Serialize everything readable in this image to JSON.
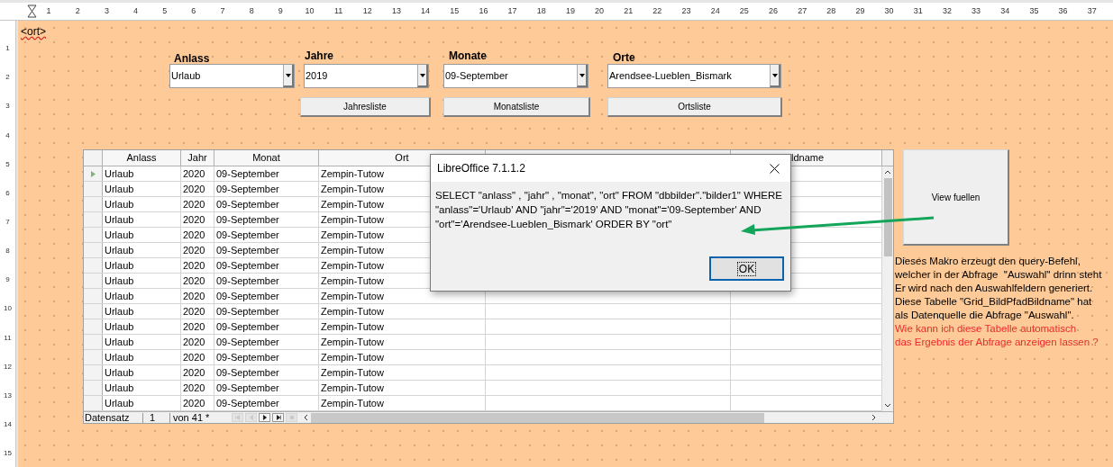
{
  "ruler": {
    "horizontal": [
      "1",
      "2",
      "3",
      "4",
      "5",
      "6",
      "7",
      "8",
      "9",
      "10",
      "11",
      "12",
      "13",
      "14",
      "15",
      "16",
      "17",
      "18",
      "19",
      "20",
      "21",
      "22",
      "23",
      "24",
      "25",
      "26",
      "27",
      "28",
      "29",
      "30",
      "31",
      "32",
      "33",
      "34",
      "35",
      "36",
      "37"
    ],
    "vertical": [
      "1",
      "2",
      "3",
      "4",
      "5",
      "6",
      "7",
      "8",
      "9",
      "10",
      "11",
      "12",
      "13",
      "14",
      "15"
    ]
  },
  "form": {
    "tag": "<ort>",
    "fields": [
      {
        "label": "Anlass",
        "value": "Urlaub"
      },
      {
        "label": "Jahre",
        "value": "2019"
      },
      {
        "label": "Monate",
        "value": "09-September"
      },
      {
        "label": "Orte",
        "value": "Arendsee-Lueblen_Bismark"
      }
    ],
    "list_buttons": [
      "Jahresliste",
      "Monatsliste",
      "Ortsliste"
    ],
    "view_button": "View fuellen",
    "note": [
      {
        "kind": "info",
        "lines": [
          "Dieses Makro erzeugt den query-Befehl,",
          "welcher in der Abfrage  \"Auswahl\" drinn steht",
          "Er wird nach den Auswahlfeldern generiert.",
          "Diese Tabelle \"Grid_BildPfadBildname\" hat",
          "als Datenquelle die Abfrage \"Auswahl\"."
        ]
      },
      {
        "kind": "question",
        "lines": [
          "Wie kann ich diese Tabelle automatisch",
          "das Ergebnis der Abfrage anzeigen lassen ?"
        ]
      }
    ]
  },
  "table": {
    "columns": [
      "Anlass",
      "Jahr",
      "Monat",
      "Ort"
    ],
    "column_7_partial": "ldname",
    "rows": [
      {
        "current": true,
        "cells": [
          "Urlaub",
          "2020",
          "09-September",
          "Zempin-Tutow"
        ]
      },
      {
        "current": false,
        "cells": [
          "Urlaub",
          "2020",
          "09-September",
          "Zempin-Tutow"
        ]
      },
      {
        "current": false,
        "cells": [
          "Urlaub",
          "2020",
          "09-September",
          "Zempin-Tutow"
        ]
      },
      {
        "current": false,
        "cells": [
          "Urlaub",
          "2020",
          "09-September",
          "Zempin-Tutow"
        ]
      },
      {
        "current": false,
        "cells": [
          "Urlaub",
          "2020",
          "09-September",
          "Zempin-Tutow"
        ]
      },
      {
        "current": false,
        "cells": [
          "Urlaub",
          "2020",
          "09-September",
          "Zempin-Tutow"
        ]
      },
      {
        "current": false,
        "cells": [
          "Urlaub",
          "2020",
          "09-September",
          "Zempin-Tutow"
        ]
      },
      {
        "current": false,
        "cells": [
          "Urlaub",
          "2020",
          "09-September",
          "Zempin-Tutow"
        ]
      },
      {
        "current": false,
        "cells": [
          "Urlaub",
          "2020",
          "09-September",
          "Zempin-Tutow"
        ]
      },
      {
        "current": false,
        "cells": [
          "Urlaub",
          "2020",
          "09-September",
          "Zempin-Tutow"
        ]
      },
      {
        "current": false,
        "cells": [
          "Urlaub",
          "2020",
          "09-September",
          "Zempin-Tutow"
        ]
      },
      {
        "current": false,
        "cells": [
          "Urlaub",
          "2020",
          "09-September",
          "Zempin-Tutow"
        ]
      },
      {
        "current": false,
        "cells": [
          "Urlaub",
          "2020",
          "09-September",
          "Zempin-Tutow"
        ]
      },
      {
        "current": false,
        "cells": [
          "Urlaub",
          "2020",
          "09-September",
          "Zempin-Tutow"
        ]
      },
      {
        "current": false,
        "cells": [
          "Urlaub",
          "2020",
          "09-September",
          "Zempin-Tutow"
        ]
      },
      {
        "current": false,
        "cells": [
          "Urlaub",
          "2020",
          "09-September",
          "Zempin-Tutow"
        ]
      }
    ],
    "navigator": {
      "label": "Datensatz",
      "record": "1",
      "total": "von 41 *",
      "buttons": [
        {
          "kind": "first",
          "disabled": true
        },
        {
          "kind": "previous",
          "disabled": true
        },
        {
          "kind": "next",
          "disabled": false
        },
        {
          "kind": "last",
          "disabled": false
        },
        {
          "kind": "new",
          "disabled": true
        }
      ]
    }
  },
  "dialog": {
    "title": "LibreOffice 7.1.1.2",
    "message": "SELECT \"anlass\" , \"jahr\" , \"monat\", \"ort\" FROM \"dbbilder\".\"bilder1\" WHERE \"anlass\"='Urlaub' AND \"jahr\"='2019' AND \"monat\"='09-September' AND \"ort\"='Arendsee-Lueblen_Bismark' ORDER BY \"ort\"",
    "button": "OK"
  }
}
